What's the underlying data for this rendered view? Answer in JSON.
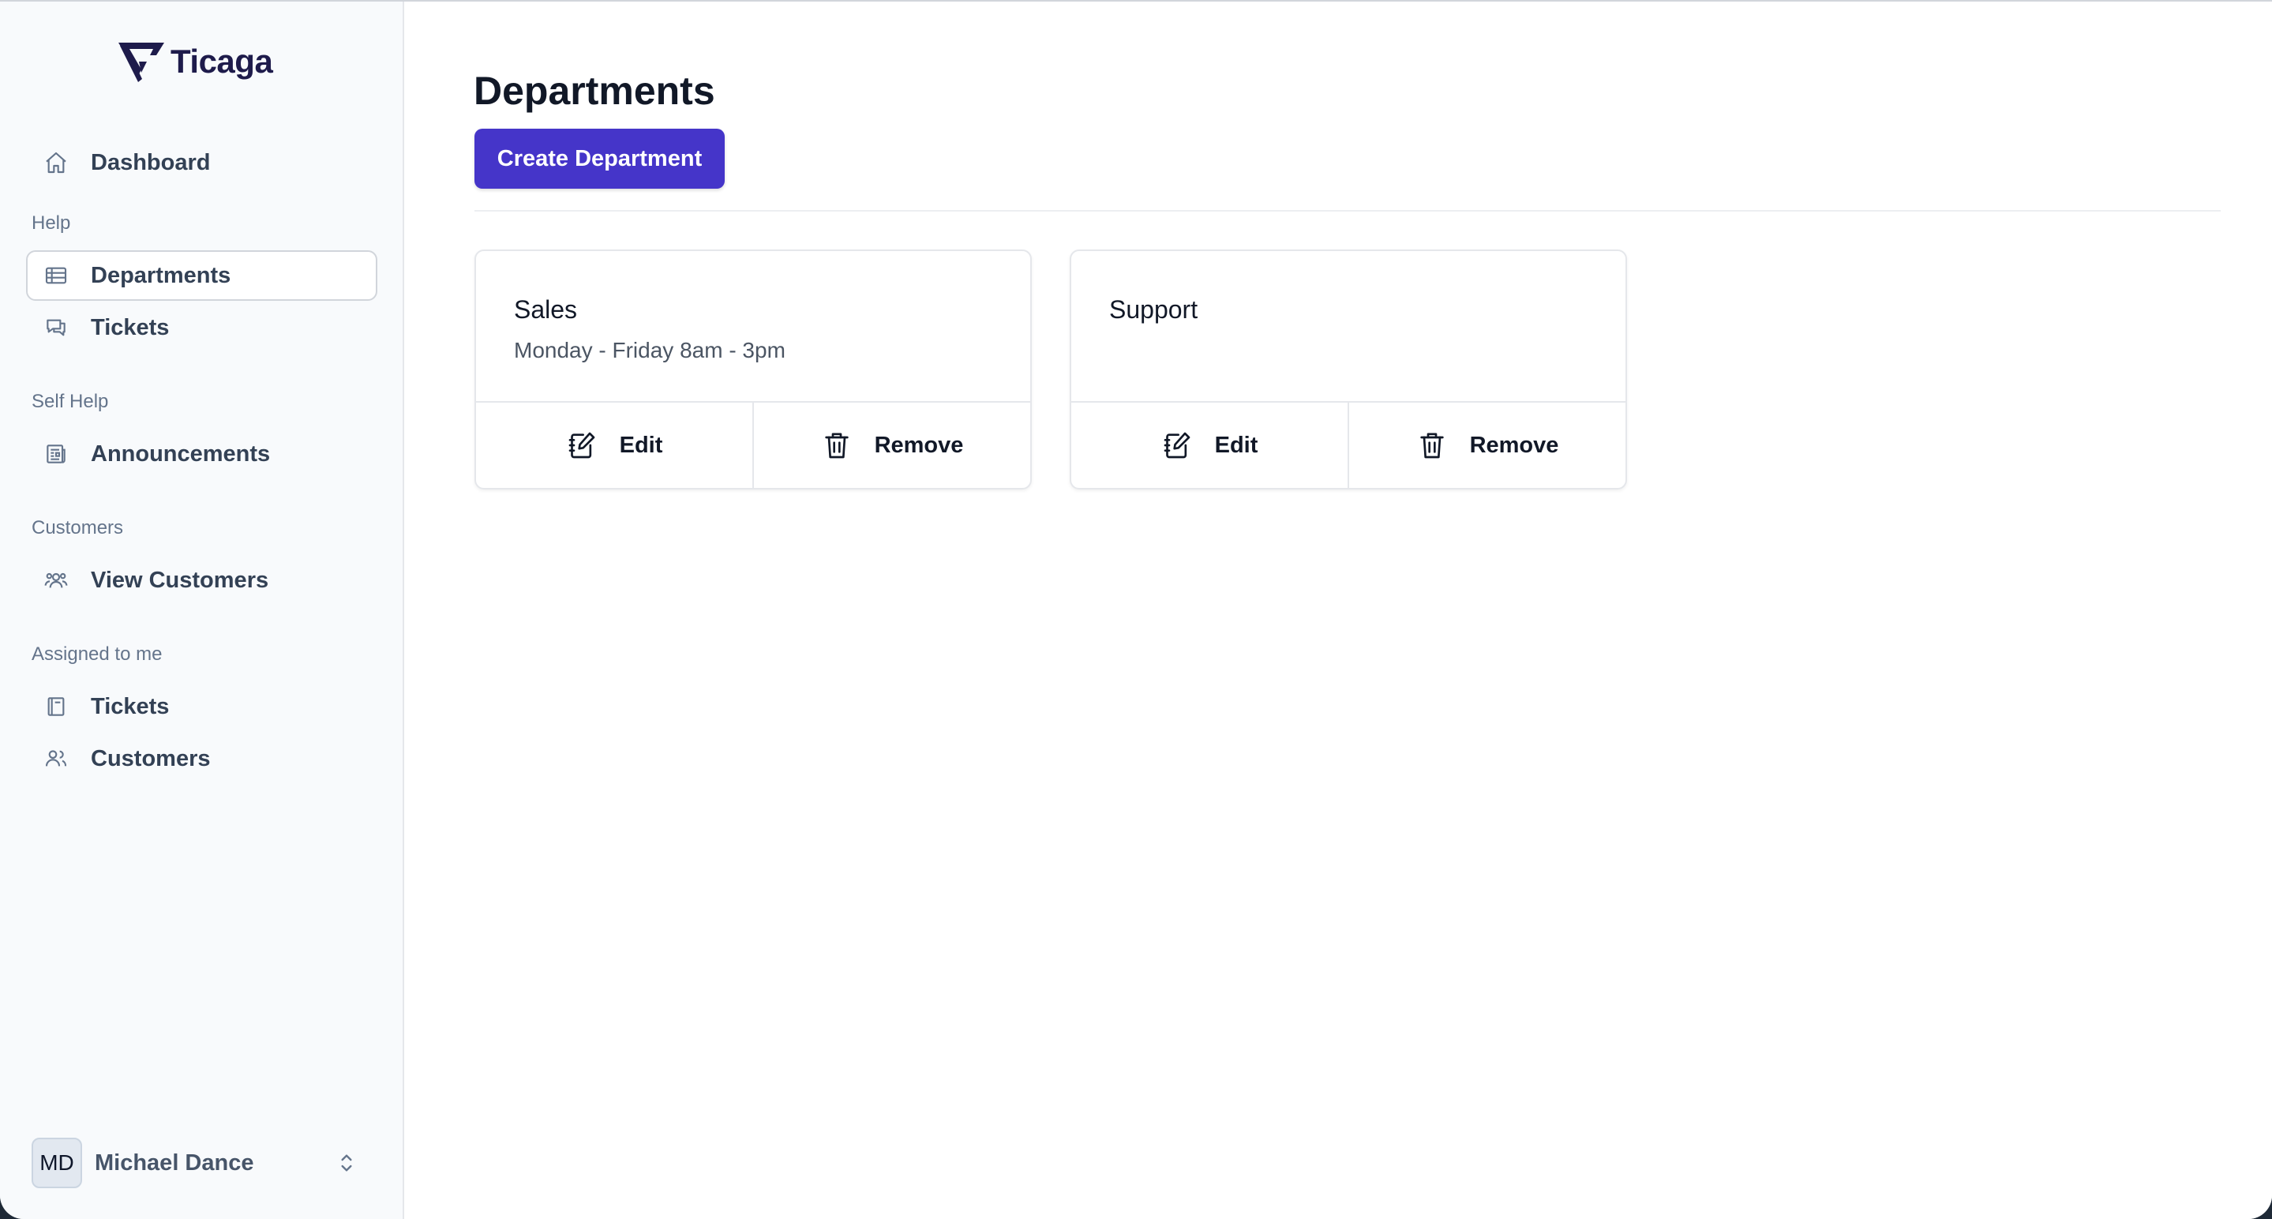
{
  "app": {
    "name": "Ticaga",
    "accent_color": "#4535c9"
  },
  "sidebar": {
    "dashboard": {
      "label": "Dashboard",
      "icon": "home-icon"
    },
    "sections": [
      {
        "label": "Help",
        "items": [
          {
            "label": "Departments",
            "icon": "table-icon",
            "active": true
          },
          {
            "label": "Tickets",
            "icon": "chat-bubbles-icon",
            "active": false
          }
        ]
      },
      {
        "label": "Self Help",
        "items": [
          {
            "label": "Announcements",
            "icon": "newspaper-icon",
            "active": false
          }
        ]
      },
      {
        "label": "Customers",
        "items": [
          {
            "label": "View Customers",
            "icon": "user-group-icon",
            "active": false
          }
        ]
      },
      {
        "label": "Assigned to me",
        "items": [
          {
            "label": "Tickets",
            "icon": "book-icon",
            "active": false
          },
          {
            "label": "Customers",
            "icon": "users-icon",
            "active": false
          }
        ]
      }
    ],
    "user": {
      "initials": "MD",
      "name": "Michael Dance"
    }
  },
  "main": {
    "title": "Departments",
    "create_button": "Create Department",
    "departments": [
      {
        "name": "Sales",
        "hours": "Monday - Friday 8am - 3pm",
        "edit_label": "Edit",
        "remove_label": "Remove"
      },
      {
        "name": "Support",
        "hours": "",
        "edit_label": "Edit",
        "remove_label": "Remove"
      }
    ]
  }
}
